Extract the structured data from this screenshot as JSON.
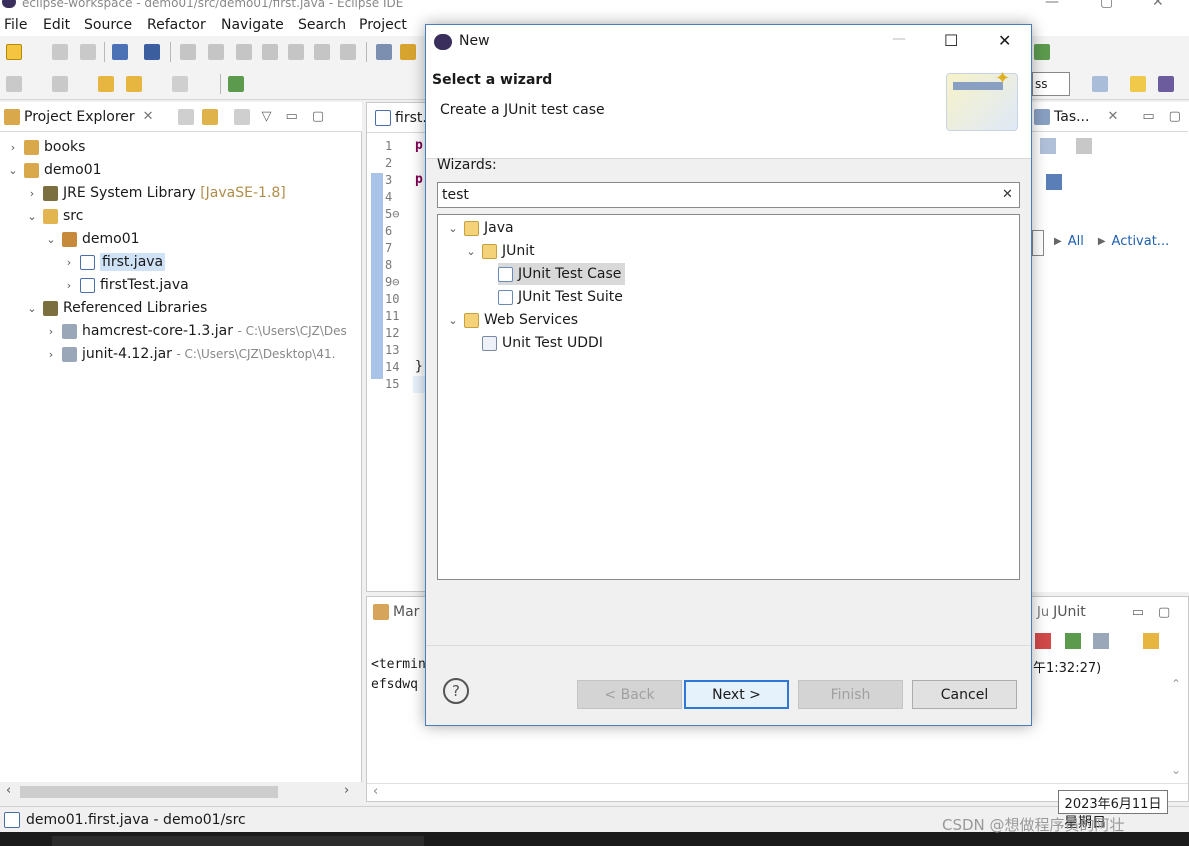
{
  "window": {
    "title": "eclipse-workspace - demo01/src/demo01/first.java - Eclipse IDE"
  },
  "menu": [
    "File",
    "Edit",
    "Source",
    "Refactor",
    "Navigate",
    "Search",
    "Project"
  ],
  "project_explorer": {
    "tab_label": "Project Explorer",
    "items": [
      {
        "label": "books",
        "depth": 0,
        "expanded": false
      },
      {
        "label": "demo01",
        "depth": 0,
        "expanded": true
      },
      {
        "label": "JRE System Library",
        "suffix": "[JavaSE-1.8]",
        "depth": 1,
        "expanded": false
      },
      {
        "label": "src",
        "depth": 1,
        "expanded": true
      },
      {
        "label": "demo01",
        "depth": 2,
        "expanded": true
      },
      {
        "label": "first.java",
        "depth": 3,
        "expanded": false,
        "selected": true
      },
      {
        "label": "firstTest.java",
        "depth": 3,
        "expanded": false
      },
      {
        "label": "Referenced Libraries",
        "depth": 1,
        "expanded": true
      },
      {
        "label": "hamcrest-core-1.3.jar",
        "suffix": "- C:\\Users\\CJZ\\Des",
        "depth": 2,
        "expanded": false
      },
      {
        "label": "junit-4.12.jar",
        "suffix": "- C:\\Users\\CJZ\\Desktop\\41.",
        "depth": 2,
        "expanded": false
      }
    ]
  },
  "editor": {
    "tab_label": "first.",
    "line_numbers": [
      "1",
      "2",
      "3",
      "4",
      "5⊖",
      "6",
      "7",
      "8",
      "9⊖",
      "10",
      "11",
      "12",
      "13",
      "14",
      "15"
    ],
    "code_fragments": [
      "p",
      "p",
      "}"
    ]
  },
  "right_panel": {
    "tab_label": "Tas...",
    "filter_all": "All",
    "filter_activate": "Activat...",
    "quick_access_fragment": "ss"
  },
  "bottom": {
    "markers_tab": "Mar",
    "junit_tab": "JUnit",
    "console_line1": "<termin",
    "console_line2": "efsdwq",
    "time_fragment": "午1:32:27)"
  },
  "status": {
    "text": "demo01.first.java - demo01/src"
  },
  "clock": {
    "date": "2023年6月11日",
    "overlay_fragment": "星期日"
  },
  "watermark": "CSDN @想做程序员的阿壮",
  "dialog": {
    "title": "New",
    "heading": "Select a wizard",
    "description": "Create a JUnit test case",
    "wizards_label": "Wizards:",
    "filter_value": "test",
    "clear_glyph": "✕",
    "tree": [
      {
        "label": "Java",
        "depth": 0,
        "type": "folder",
        "expanded": true
      },
      {
        "label": "JUnit",
        "depth": 1,
        "type": "folder",
        "expanded": true
      },
      {
        "label": "JUnit Test Case",
        "depth": 2,
        "type": "wizard",
        "selected": true
      },
      {
        "label": "JUnit Test Suite",
        "depth": 2,
        "type": "wizard"
      },
      {
        "label": "Web Services",
        "depth": 0,
        "type": "folder",
        "expanded": true
      },
      {
        "label": "Unit Test UDDI",
        "depth": 1,
        "type": "wizard"
      }
    ],
    "buttons": {
      "help": "?",
      "back": "< Back",
      "next": "Next >",
      "finish": "Finish",
      "cancel": "Cancel"
    }
  }
}
